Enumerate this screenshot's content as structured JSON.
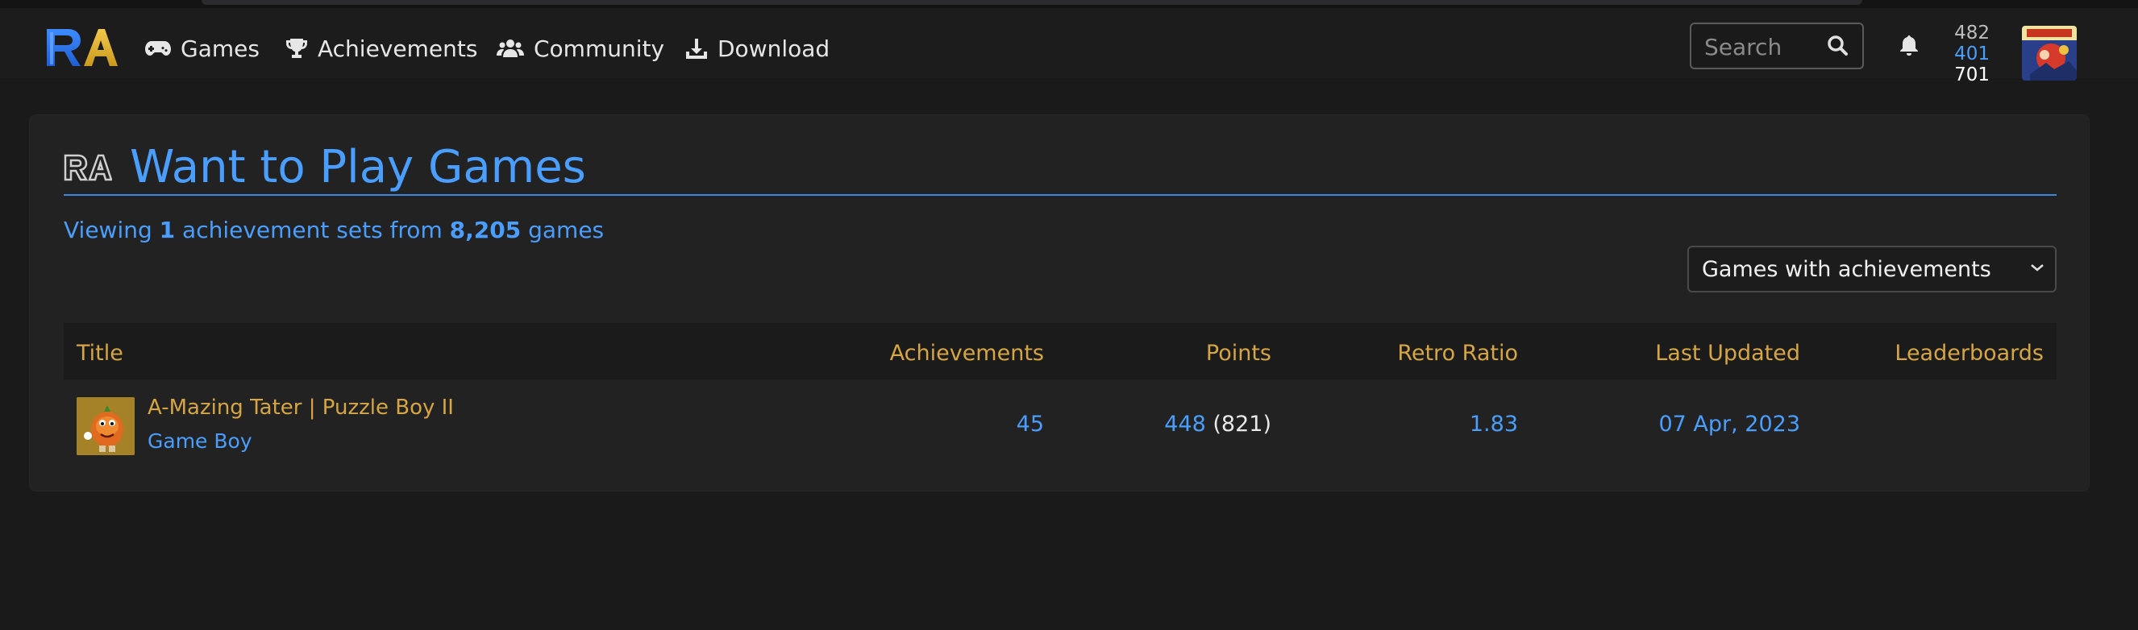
{
  "nav": {
    "items": [
      {
        "label": "Games",
        "icon": "gamepad-icon"
      },
      {
        "label": "Achievements",
        "icon": "trophy-icon"
      },
      {
        "label": "Community",
        "icon": "users-icon"
      },
      {
        "label": "Download",
        "icon": "download-icon"
      }
    ],
    "search_placeholder": "Search",
    "user_stats": [
      "482",
      "401",
      "701"
    ]
  },
  "page": {
    "title": "Want to Play Games",
    "viewing_prefix": "Viewing",
    "viewing_count": "1",
    "viewing_middle": "achievement sets from",
    "viewing_total": "8,205",
    "viewing_suffix": "games",
    "filter_value": "Games with achievements"
  },
  "table": {
    "headers": [
      "Title",
      "Achievements",
      "Points",
      "Retro Ratio",
      "Last Updated",
      "Leaderboards"
    ],
    "rows": [
      {
        "title": "A-Mazing Tater | Puzzle Boy II",
        "system": "Game Boy",
        "achievements": "45",
        "points": "448",
        "retro_points": "(821)",
        "retro_ratio": "1.83",
        "last_updated": "07 Apr, 2023",
        "leaderboards": ""
      }
    ]
  },
  "colors": {
    "accent_blue": "#4a9eff",
    "header_gold": "#d6a544",
    "background": "#1a1a1a",
    "panel": "#222222"
  }
}
